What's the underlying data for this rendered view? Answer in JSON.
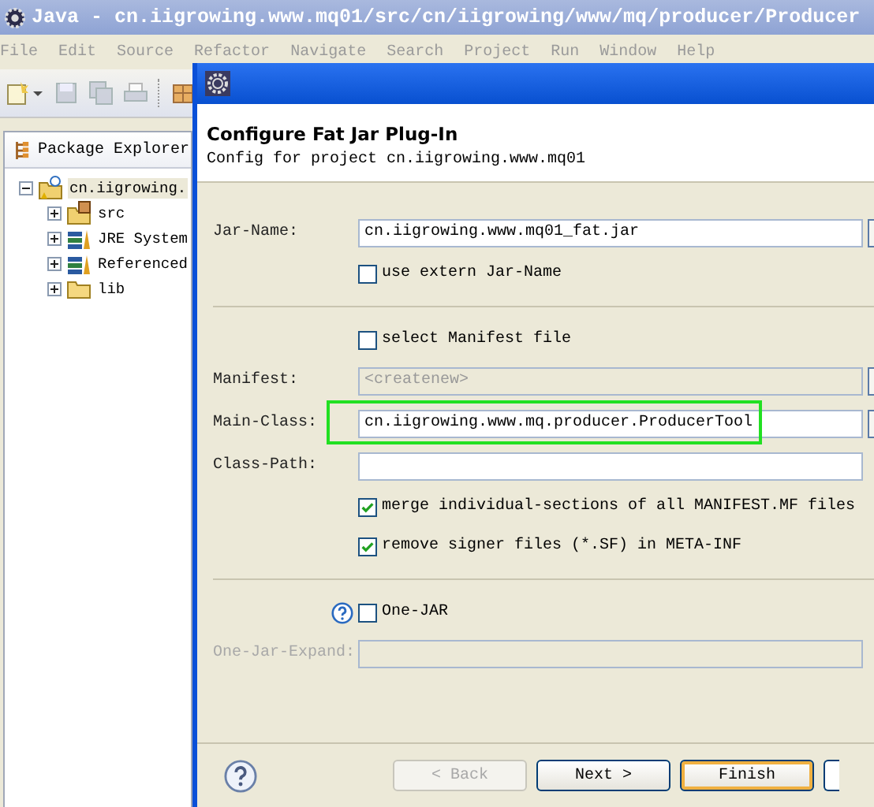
{
  "window": {
    "title": "Java - cn.iigrowing.www.mq01/src/cn/iigrowing/www/mq/producer/Producer"
  },
  "menu": [
    "File",
    "Edit",
    "Source",
    "Refactor",
    "Navigate",
    "Search",
    "Project",
    "Run",
    "Window",
    "Help"
  ],
  "package_explorer": {
    "title": "Package Explorer",
    "tree": [
      {
        "label": "cn.iigrowing.",
        "kind": "project",
        "expanded": true,
        "selected": true,
        "children": [
          {
            "label": "src",
            "kind": "source",
            "expanded": false,
            "selected": false
          },
          {
            "label": "JRE System",
            "kind": "library",
            "expanded": false,
            "selected": false
          },
          {
            "label": "Referenced",
            "kind": "library",
            "expanded": false,
            "selected": false
          },
          {
            "label": "lib",
            "kind": "folder",
            "expanded": false,
            "selected": false
          }
        ]
      }
    ]
  },
  "dialog": {
    "heading": "Configure Fat Jar Plug-In",
    "subtitle": "Config for project cn.iigrowing.www.mq01",
    "rows": [
      {
        "kind": "text",
        "label": "Jar-Name:",
        "value": "cn.iigrowing.www.mq01_fat.jar",
        "disabled": false,
        "label_disabled": false,
        "browse": true
      },
      {
        "kind": "checkbox",
        "label": "use extern Jar-Name",
        "checked": false
      },
      {
        "kind": "separator"
      },
      {
        "kind": "checkbox",
        "label": "select Manifest file",
        "checked": false
      },
      {
        "kind": "text",
        "label": "Manifest:",
        "value": "<createnew>",
        "disabled": true,
        "label_disabled": false,
        "browse": true
      },
      {
        "kind": "text",
        "label": "Main-Class:",
        "value": "cn.iigrowing.www.mq.producer.ProducerTool",
        "disabled": false,
        "label_disabled": false,
        "highlighted": true,
        "browse": true
      },
      {
        "kind": "text",
        "label": "Class-Path:",
        "disabled": false,
        "label_disabled": false
      },
      {
        "kind": "checkbox",
        "label": "merge individual-sections of all MANIFEST.MF files",
        "checked": true
      },
      {
        "kind": "checkbox",
        "label": "remove signer files (*.SF) in META-INF",
        "checked": true
      },
      {
        "kind": "separator"
      },
      {
        "kind": "checkbox",
        "label": "One-JAR",
        "checked": false,
        "help": true
      },
      {
        "kind": "text",
        "label": "One-Jar-Expand:",
        "disabled": true,
        "label_disabled": true
      }
    ],
    "buttons": [
      {
        "label": "< Back",
        "disabled": true,
        "default": false
      },
      {
        "label": "Next >",
        "disabled": false,
        "default": false
      },
      {
        "label": "Finish",
        "disabled": false,
        "default": true
      }
    ]
  }
}
